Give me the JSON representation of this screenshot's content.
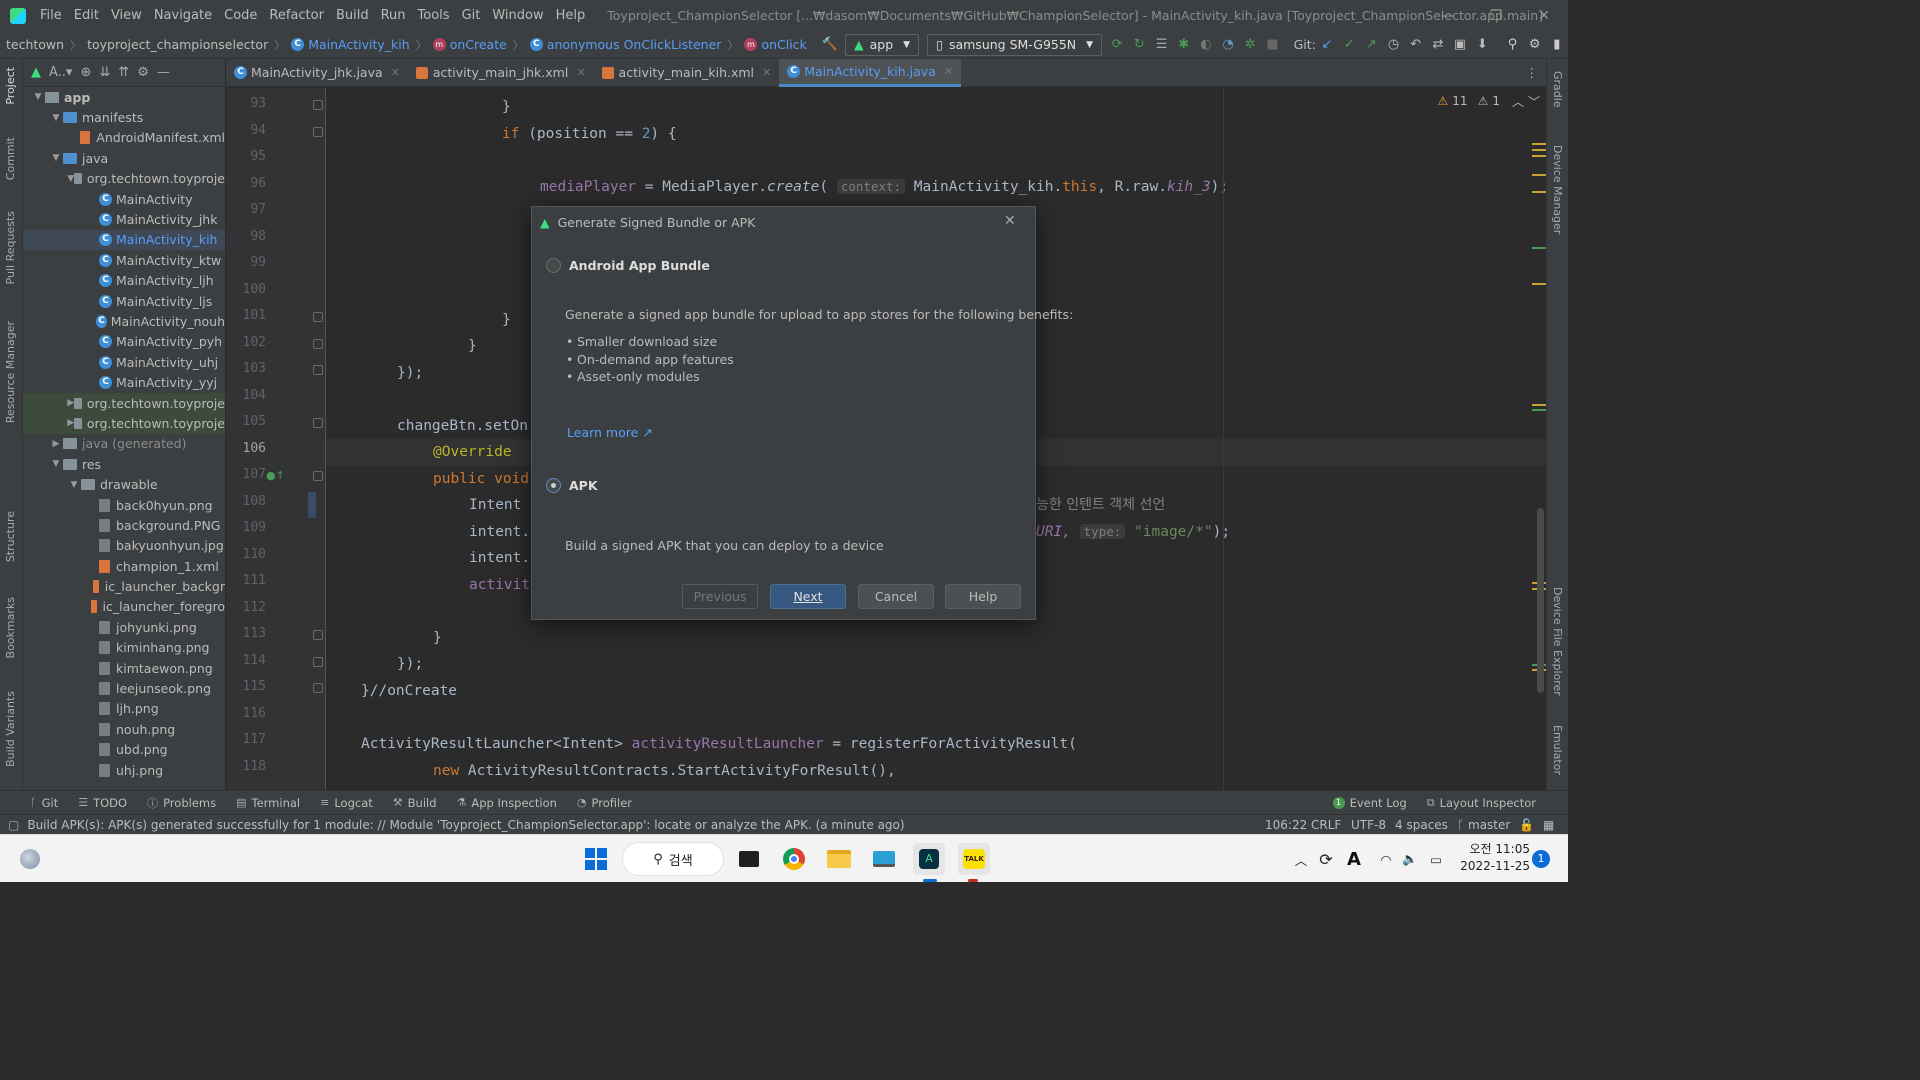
{
  "menubar": {
    "items": [
      "File",
      "Edit",
      "View",
      "Navigate",
      "Code",
      "Refactor",
      "Build",
      "Run",
      "Tools",
      "Git",
      "Window",
      "Help"
    ],
    "title": "Toyproject_ChampionSelector [...₩dasom₩Documents₩GitHub₩ChampionSelector] - MainActivity_kih.java [Toyproject_ChampionSelector.app.main]"
  },
  "navbar": {
    "crumbs": [
      "techtown",
      "toyproject_championselector",
      "MainActivity_kih",
      "onCreate",
      "anonymous OnClickListener",
      "onClick"
    ],
    "run_config": "app",
    "device": "samsung SM-G955N",
    "git_label": "Git:"
  },
  "project": {
    "header": "A..▾",
    "tree": [
      {
        "label": "app",
        "depth": 0,
        "arrow": "▼",
        "type": "folder"
      },
      {
        "label": "manifests",
        "depth": 1,
        "arrow": "▼",
        "type": "folder-blue"
      },
      {
        "label": "AndroidManifest.xml",
        "depth": 2,
        "arrow": "",
        "type": "xml"
      },
      {
        "label": "java",
        "depth": 1,
        "arrow": "▼",
        "type": "folder-blue"
      },
      {
        "label": "org.techtown.toyproje",
        "depth": 2,
        "arrow": "▼",
        "type": "folder"
      },
      {
        "label": "MainActivity",
        "depth": 3,
        "arrow": "",
        "type": "class"
      },
      {
        "label": "MainActivity_jhk",
        "depth": 3,
        "arrow": "",
        "type": "class"
      },
      {
        "label": "MainActivity_kih",
        "depth": 3,
        "arrow": "",
        "type": "class",
        "selected": true
      },
      {
        "label": "MainActivity_ktw",
        "depth": 3,
        "arrow": "",
        "type": "class"
      },
      {
        "label": "MainActivity_ljh",
        "depth": 3,
        "arrow": "",
        "type": "class"
      },
      {
        "label": "MainActivity_ljs",
        "depth": 3,
        "arrow": "",
        "type": "class"
      },
      {
        "label": "MainActivity_nouh",
        "depth": 3,
        "arrow": "",
        "type": "class"
      },
      {
        "label": "MainActivity_pyh",
        "depth": 3,
        "arrow": "",
        "type": "class"
      },
      {
        "label": "MainActivity_uhj",
        "depth": 3,
        "arrow": "",
        "type": "class"
      },
      {
        "label": "MainActivity_yyj",
        "depth": 3,
        "arrow": "",
        "type": "class"
      },
      {
        "label": "org.techtown.toyproje",
        "depth": 2,
        "arrow": "▶",
        "type": "folder",
        "hl": true
      },
      {
        "label": "org.techtown.toyproje",
        "depth": 2,
        "arrow": "▶",
        "type": "folder",
        "hl": true
      },
      {
        "label": "java (generated)",
        "depth": 1,
        "arrow": "▶",
        "type": "folder"
      },
      {
        "label": "res",
        "depth": 1,
        "arrow": "▼",
        "type": "folder"
      },
      {
        "label": "drawable",
        "depth": 2,
        "arrow": "▼",
        "type": "folder"
      },
      {
        "label": "back0hyun.png",
        "depth": 3,
        "arrow": "",
        "type": "file"
      },
      {
        "label": "background.PNG",
        "depth": 3,
        "arrow": "",
        "type": "file"
      },
      {
        "label": "bakyuonhyun.jpg",
        "depth": 3,
        "arrow": "",
        "type": "file"
      },
      {
        "label": "champion_1.xml",
        "depth": 3,
        "arrow": "",
        "type": "xml"
      },
      {
        "label": "ic_launcher_backgr",
        "depth": 3,
        "arrow": "",
        "type": "xml"
      },
      {
        "label": "ic_launcher_foregro",
        "depth": 3,
        "arrow": "",
        "type": "xml"
      },
      {
        "label": "johyunki.png",
        "depth": 3,
        "arrow": "",
        "type": "file"
      },
      {
        "label": "kiminhang.png",
        "depth": 3,
        "arrow": "",
        "type": "file"
      },
      {
        "label": "kimtaewon.png",
        "depth": 3,
        "arrow": "",
        "type": "file"
      },
      {
        "label": "leejunseok.png",
        "depth": 3,
        "arrow": "",
        "type": "file"
      },
      {
        "label": "ljh.png",
        "depth": 3,
        "arrow": "",
        "type": "file"
      },
      {
        "label": "nouh.png",
        "depth": 3,
        "arrow": "",
        "type": "file"
      },
      {
        "label": "ubd.png",
        "depth": 3,
        "arrow": "",
        "type": "file"
      },
      {
        "label": "uhj.png",
        "depth": 3,
        "arrow": "",
        "type": "file"
      }
    ]
  },
  "tabs": [
    {
      "label": "MainActivity_jhk.java",
      "kind": "class"
    },
    {
      "label": "activity_main_jhk.xml",
      "kind": "xml"
    },
    {
      "label": "activity_main_kih.xml",
      "kind": "xml"
    },
    {
      "label": "MainActivity_kih.java",
      "kind": "class",
      "active": true
    }
  ],
  "editor": {
    "line_numbers": [
      "93",
      "94",
      "95",
      "96",
      "97",
      "98",
      "99",
      "100",
      "101",
      "102",
      "103",
      "104",
      "105",
      "106",
      "107",
      "108",
      "109",
      "110",
      "111",
      "112",
      "113",
      "114",
      "115",
      "116",
      "117",
      "118"
    ],
    "current_line": "106",
    "warnings": "11",
    "weak_warnings": "1",
    "code": {
      "l93": "}",
      "l94_kw": "if",
      "l94_a": " (position == ",
      "l94_num": "2",
      "l94_b": ") {",
      "l96_fld": "mediaPlayer",
      "l96_a": " = MediaPlayer.",
      "l96_m": "create",
      "l96_b": "( ",
      "l96_hint": "context:",
      "l96_c": " MainActivity_kih.",
      "l96_this": "this",
      "l96_d": ", R.raw.",
      "l96_res": "kih_3",
      "l96_e": ");",
      "l101": "}",
      "l102": "}",
      "l103": "});",
      "l105": "changeBtn.setOn",
      "l106": "@Override",
      "l107_kw": "public void",
      "l108": "Intent",
      "l108_kor": "능한 인텐트 객체 선언",
      "l109": "intent.",
      "l109_uri": "URI,",
      "l109_hint": "type:",
      "l109_str": "\"image/*\"",
      "l109_end": ");",
      "l110": "intent.",
      "l111": "activit",
      "l113": "}",
      "l114": "});",
      "l115": "}//onCreate",
      "l117_a": "ActivityResultLauncher<Intent> ",
      "l117_fld": "activityResultLauncher",
      "l117_b": " = registerForActivityResult(",
      "l118_kw": "new",
      "l118_a": " ActivityResultContracts.StartActivityForResult(),"
    }
  },
  "left_tool_tabs": [
    "Project",
    "Commit",
    "Pull Requests",
    "Resource Manager",
    "Structure",
    "Bookmarks",
    "Build Variants"
  ],
  "right_tool_tabs": [
    "Gradle",
    "Device Manager",
    "Device File Explorer",
    "Emulator"
  ],
  "dialog": {
    "title": "Generate Signed Bundle or APK",
    "option_bundle": "Android App Bundle",
    "bundle_desc": "Generate a signed app bundle for upload to app stores for the following benefits:",
    "benefits": [
      "Smaller download size",
      "On-demand app features",
      "Asset-only modules"
    ],
    "learn_more": "Learn more ↗",
    "option_apk": "APK",
    "apk_desc": "Build a signed APK that you can deploy to a device",
    "selected": "APK",
    "btn_previous": "Previous",
    "btn_next": "Next",
    "btn_cancel": "Cancel",
    "btn_help": "Help"
  },
  "bottom_tabs": [
    "Git",
    "TODO",
    "Problems",
    "Terminal",
    "Logcat",
    "Build",
    "App Inspection",
    "Profiler"
  ],
  "bottom_right_tabs": [
    "Event Log",
    "Layout Inspector"
  ],
  "event_log_count": "1",
  "status": {
    "message": "Build APK(s): APK(s) generated successfully for 1 module: // Module 'Toyproject_ChampionSelector.app': locate or analyze the APK. (a minute ago)",
    "position": "106:22",
    "line_sep": "CRLF",
    "encoding": "UTF-8",
    "indent": "4 spaces",
    "branch": "master"
  },
  "taskbar": {
    "search": "검색",
    "time": "오전 11:05",
    "date": "2022-11-25",
    "notif": "1",
    "ime": "A"
  }
}
